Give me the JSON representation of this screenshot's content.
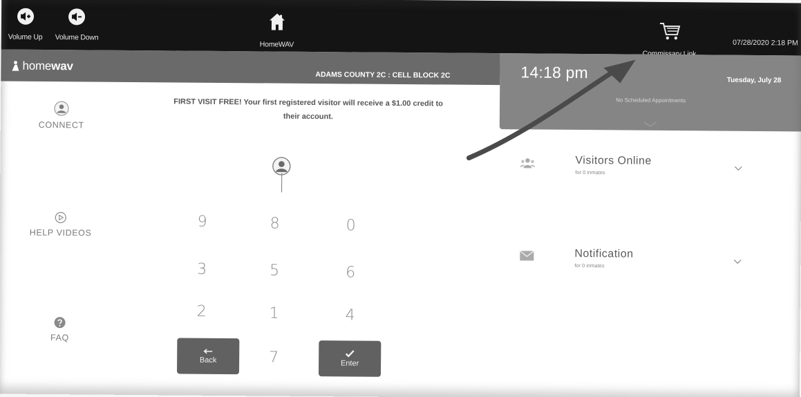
{
  "system_bar": {
    "volume_up_label": "Volume Up",
    "volume_down_label": "Volume Down",
    "home_label": "HomeWAV",
    "commissary_label": "Commissary Link",
    "datetime": "07/28/2020 2:18 PM",
    "icons": [
      "volume-up-icon",
      "volume-down-icon",
      "home-icon",
      "cart-icon"
    ]
  },
  "header": {
    "logo_prefix": "home",
    "logo_bold": "wav",
    "facility": "ADAMS COUNTY 2C : CELL BLOCK 2C"
  },
  "clock": {
    "time": "14:18 pm",
    "date": "Tuesday, July 28",
    "appointments": "No Scheduled Appointments"
  },
  "nav": {
    "connect": "CONNECT",
    "help_videos": "HELP VIDEOS",
    "faq": "FAQ"
  },
  "promo": {
    "line1": "FIRST VISIT FREE! Your first registered visitor will receive a $1.00 credit to",
    "line2": "their account."
  },
  "keypad": {
    "keys": [
      "9",
      "8",
      "0",
      "3",
      "5",
      "6",
      "2",
      "1",
      "4",
      "7"
    ],
    "back_label": "Back",
    "enter_label": "Enter"
  },
  "panel": {
    "visitors_title": "Visitors Online",
    "visitors_sub": "for 0 inmates",
    "notification_title": "Notification",
    "notification_sub": "for 0 inmates"
  },
  "colors": {
    "system_bar": "#141414",
    "header": "#6a6a6a",
    "clock_panel": "#858585",
    "button": "#616161"
  }
}
